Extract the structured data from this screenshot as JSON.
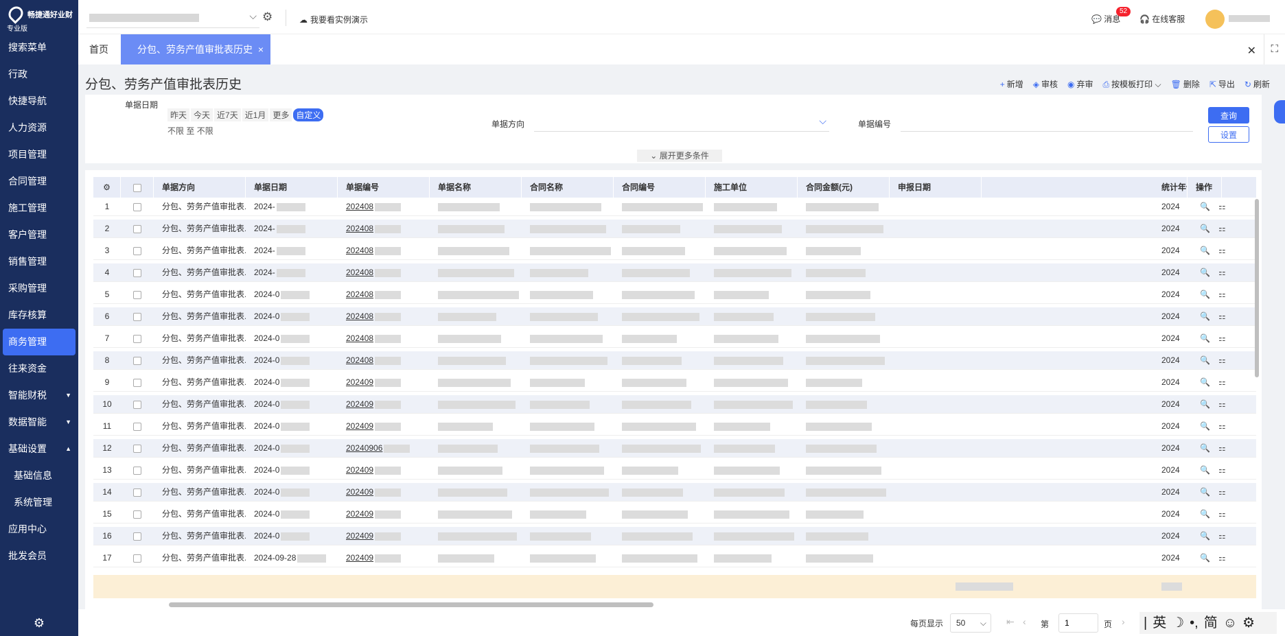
{
  "sidebar": {
    "brand": "畅捷通好业财",
    "edition": "专业版",
    "items": [
      {
        "label": "搜索菜单",
        "caret": ""
      },
      {
        "label": "行政",
        "caret": ""
      },
      {
        "label": "快捷导航",
        "caret": ""
      },
      {
        "label": "人力资源",
        "caret": ""
      },
      {
        "label": "项目管理",
        "caret": ""
      },
      {
        "label": "合同管理",
        "caret": ""
      },
      {
        "label": "施工管理",
        "caret": ""
      },
      {
        "label": "客户管理",
        "caret": ""
      },
      {
        "label": "销售管理",
        "caret": ""
      },
      {
        "label": "采购管理",
        "caret": ""
      },
      {
        "label": "库存核算",
        "caret": ""
      },
      {
        "label": "商务管理",
        "caret": ""
      },
      {
        "label": "往来资金",
        "caret": ""
      },
      {
        "label": "智能财税",
        "caret": "▼"
      },
      {
        "label": "数据智能",
        "caret": "▼"
      },
      {
        "label": "基础设置",
        "caret": "▲"
      },
      {
        "label": "基础信息",
        "caret": ""
      },
      {
        "label": "系统管理",
        "caret": ""
      },
      {
        "label": "应用中心",
        "caret": ""
      },
      {
        "label": "批发会员",
        "caret": ""
      }
    ],
    "active_index": 11,
    "settings_icon": "⚙"
  },
  "topbar": {
    "demo_label": "我要看实例演示",
    "messages_label": "消息",
    "messages_count": "52",
    "service_label": "在线客服"
  },
  "tabs": {
    "home": "首页",
    "active": "分包、劳务产值审批表历史",
    "close": "×",
    "close_all": "✕",
    "fullscreen": "⛶"
  },
  "page": {
    "title": "分包、劳务产值审批表历史",
    "toolbar": [
      {
        "icon": "+",
        "label": "新增"
      },
      {
        "icon": "◈",
        "label": "审核"
      },
      {
        "icon": "◉",
        "label": "弃审"
      },
      {
        "icon": "⎙",
        "label": "按模板打印 ⌵"
      },
      {
        "icon": "🗑",
        "label": "删除"
      },
      {
        "icon": "⇱",
        "label": "导出"
      },
      {
        "icon": "↻",
        "label": "刷新"
      }
    ]
  },
  "filter": {
    "date_label": "单据日期",
    "date_chips": [
      "昨天",
      "今天",
      "近7天",
      "近1月",
      "更多"
    ],
    "date_custom": "自定义",
    "date_from": "不限",
    "date_to_word": "至",
    "date_to": "不限",
    "direction_label": "单据方向",
    "direction_value": "",
    "docno_label": "单据编号",
    "docno_value": "",
    "query_button": "查询",
    "settings_button": "设置",
    "expand_label": "展开更多条件"
  },
  "table": {
    "columns": [
      "单据方向",
      "单据日期",
      "单据编号",
      "单据名称",
      "合同名称",
      "合同编号",
      "施工单位",
      "合同金额(元)",
      "申报日期",
      "统计年份",
      "操作"
    ],
    "rows": [
      {
        "no": "1",
        "direction": "分包、劳务产值审批表...",
        "date": "2024-",
        "docno": "202408",
        "year": "2024"
      },
      {
        "no": "2",
        "direction": "分包、劳务产值审批表...",
        "date": "2024-",
        "docno": "202408",
        "year": "2024"
      },
      {
        "no": "3",
        "direction": "分包、劳务产值审批表...",
        "date": "2024-",
        "docno": "202408",
        "year": "2024"
      },
      {
        "no": "4",
        "direction": "分包、劳务产值审批表...",
        "date": "2024-",
        "docno": "202408",
        "year": "2024"
      },
      {
        "no": "5",
        "direction": "分包、劳务产值审批表...",
        "date": "2024-0",
        "docno": "202408",
        "year": "2024"
      },
      {
        "no": "6",
        "direction": "分包、劳务产值审批表...",
        "date": "2024-0",
        "docno": "202408",
        "year": "2024"
      },
      {
        "no": "7",
        "direction": "分包、劳务产值审批表...",
        "date": "2024-0",
        "docno": "202408",
        "year": "2024"
      },
      {
        "no": "8",
        "direction": "分包、劳务产值审批表...",
        "date": "2024-0",
        "docno": "202408",
        "year": "2024"
      },
      {
        "no": "9",
        "direction": "分包、劳务产值审批表...",
        "date": "2024-0",
        "docno": "202409",
        "year": "2024"
      },
      {
        "no": "10",
        "direction": "分包、劳务产值审批表...",
        "date": "2024-0",
        "docno": "202409",
        "year": "2024"
      },
      {
        "no": "11",
        "direction": "分包、劳务产值审批表...",
        "date": "2024-0",
        "docno": "202409",
        "year": "2024"
      },
      {
        "no": "12",
        "direction": "分包、劳务产值审批表...",
        "date": "2024-0",
        "docno": "20240906",
        "year": "2024"
      },
      {
        "no": "13",
        "direction": "分包、劳务产值审批表...",
        "date": "2024-0",
        "docno": "202409",
        "year": "2024"
      },
      {
        "no": "14",
        "direction": "分包、劳务产值审批表...",
        "date": "2024-0",
        "docno": "202409",
        "year": "2024"
      },
      {
        "no": "15",
        "direction": "分包、劳务产值审批表...",
        "date": "2024-0",
        "docno": "202409",
        "year": "2024"
      },
      {
        "no": "16",
        "direction": "分包、劳务产值审批表...",
        "date": "2024-0",
        "docno": "202409",
        "year": "2024"
      },
      {
        "no": "17",
        "direction": "分包、劳务产值审批表...",
        "date": "2024-09-28",
        "docno": "202409",
        "year": "2024"
      }
    ],
    "action_icons": [
      "view-icon",
      "qr-icon"
    ]
  },
  "pager": {
    "page_size_label": "每页显示",
    "page_size": "50",
    "page_prefix": "第",
    "page_value": "1",
    "page_suffix": "页"
  },
  "ime": {
    "items": [
      "|",
      "英",
      "☽",
      "•,",
      "简",
      "☺",
      "⚙"
    ]
  },
  "colors": {
    "sidebar_bg": "#1a2e5e",
    "accent": "#3d6df2",
    "active_tab": "#6b8cf5",
    "summary_row": "#fcefd6",
    "badge": "#f5222d"
  }
}
